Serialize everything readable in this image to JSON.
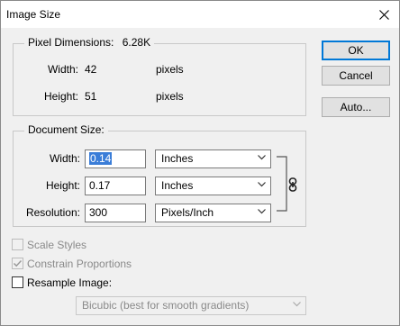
{
  "window": {
    "title": "Image Size"
  },
  "pixel_dimensions": {
    "legend": "Pixel Dimensions:",
    "size": "6.28K",
    "width_label": "Width:",
    "width_value": "42",
    "width_unit": "pixels",
    "height_label": "Height:",
    "height_value": "51",
    "height_unit": "pixels"
  },
  "buttons": {
    "ok": "OK",
    "cancel": "Cancel",
    "auto": "Auto..."
  },
  "document_size": {
    "legend": "Document Size:",
    "width_label": "Width:",
    "width_value": "0.14",
    "width_unit": "Inches",
    "height_label": "Height:",
    "height_value": "0.17",
    "height_unit": "Inches",
    "resolution_label": "Resolution:",
    "resolution_value": "300",
    "resolution_unit": "Pixels/Inch"
  },
  "options": {
    "scale_styles": {
      "label": "Scale Styles",
      "checked": false,
      "enabled": false
    },
    "constrain_proportions": {
      "label": "Constrain Proportions",
      "checked": true,
      "enabled": false
    },
    "resample_image": {
      "label": "Resample Image:",
      "checked": false,
      "enabled": true
    },
    "resample_method": "Bicubic (best for smooth gradients)"
  },
  "icons": {
    "close": "close-icon",
    "link": "chain-link-icon",
    "dropdown": "chevron-down-icon"
  }
}
